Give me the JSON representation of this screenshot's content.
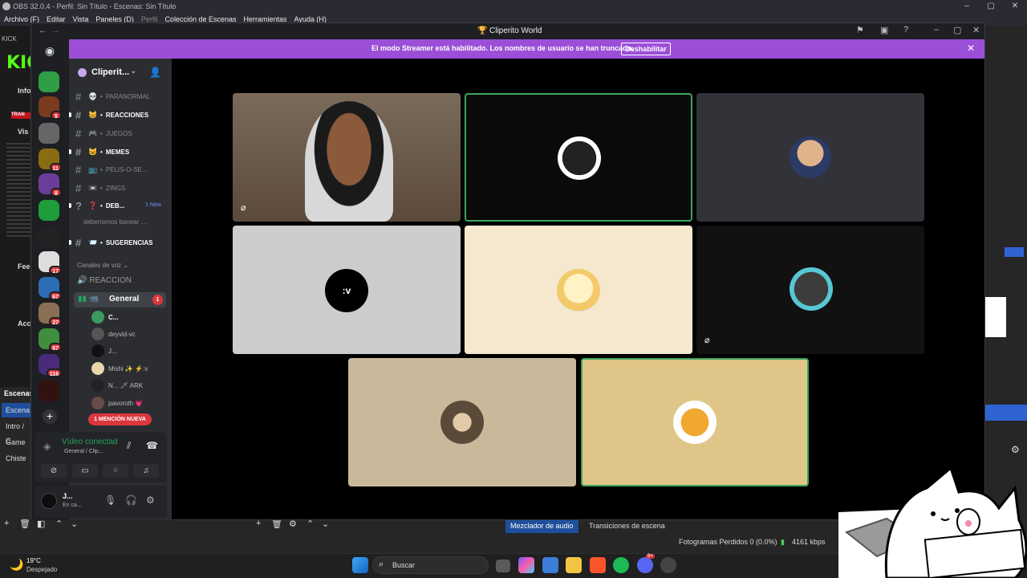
{
  "obs": {
    "title": "OBS 32.0.4 - Perfil: Sin Título - Escenas: Sin Título",
    "menu": [
      "Archivo (F)",
      "Editar",
      "Vista",
      "Paneles (D)",
      "Perfil",
      "Colección de Escenas",
      "Herramientas",
      "Ayuda (H)"
    ],
    "source_label": "KICK",
    "kick_logo": "KICK",
    "left_labels": [
      "Info",
      "Vis",
      "Fee",
      "Acc"
    ],
    "tran_label": "TRAN",
    "scenes_header": "Escenas",
    "scenes": [
      "Escena",
      "Intro / C",
      "Game",
      "Chiste"
    ],
    "tabs": {
      "mixer": "Mezclador de audio",
      "transitions": "Transiciones de escena"
    },
    "status": "Fotogramas Perdidos 0 (0.0%)",
    "kbps": "4161 kbps"
  },
  "taskbar": {
    "weather_temp": "19°C",
    "weather_desc": "Despejado",
    "search": "Buscar",
    "discord_badge": "9+"
  },
  "discord": {
    "window_title": "Cliperito World",
    "banner_text": "El modo Streamer está habilitado. Los nombres de usuario se han truncado.",
    "banner_button": "Deshabilitar",
    "server_name": "Clipe­rit...",
    "servers": [
      {
        "color": "#2f9e44",
        "badge": ""
      },
      {
        "color": "#7a3b1e",
        "badge": "5"
      },
      {
        "color": "#666666",
        "badge": ""
      },
      {
        "color": "#8a6d12",
        "badge": "11"
      },
      {
        "color": "#6b3d9a",
        "badge": "8"
      },
      {
        "color": "#1f9d3a",
        "badge": ""
      },
      {
        "color": "#222222",
        "badge": ""
      },
      {
        "color": "#dddddd",
        "badge": "17"
      },
      {
        "color": "#2d6db5",
        "badge": "67"
      },
      {
        "color": "#8a6f55",
        "badge": "27"
      },
      {
        "color": "#3e8e3e",
        "badge": "67"
      },
      {
        "color": "#4a2a7a",
        "badge": "116"
      },
      {
        "color": "#331111",
        "badge": ""
      }
    ],
    "channels": [
      {
        "emoji": "💀",
        "name": "PARANORMAL",
        "unread": false
      },
      {
        "emoji": "😸",
        "name": "REACCIONES",
        "unread": true
      },
      {
        "emoji": "🎮",
        "name": "JUEGOS",
        "unread": false
      },
      {
        "emoji": "😺",
        "name": "MEMES",
        "unread": true
      },
      {
        "emoji": "📺",
        "name": "PELIS-O-SE...",
        "unread": false
      },
      {
        "emoji": "📼",
        "name": "ZINGS",
        "unread": false
      },
      {
        "emoji": "❓",
        "name": "DEB...",
        "unread": true
      },
      {
        "emoji": "📨",
        "name": "SUGERENCIAS",
        "unread": true
      }
    ],
    "new_tag": "1 New",
    "thread": "deberíamos banear ...",
    "voice_category": "Canales de voz",
    "voice_channels": [
      "REACCION",
      "General"
    ],
    "general_badge": "1",
    "voice_users": [
      "C...",
      "deyvid-vc",
      "J...",
      "Mishi ✨ ⚡:v",
      "N... 🗡 ARK",
      "pavoroth 💗"
    ],
    "mention_pill": "1 MENCIÓN NUEVA",
    "voice_status": "Vídeo conectad",
    "voice_sub": "General / Clip...",
    "user_name": "J...",
    "user_status": "En ca..."
  },
  "video": {
    "text_avatar": ":v"
  }
}
